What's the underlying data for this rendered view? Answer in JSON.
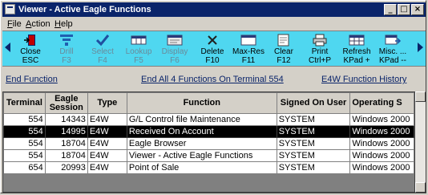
{
  "window": {
    "title": "Viewer - Active Eagle Functions"
  },
  "menu": [
    {
      "key": "F",
      "rest": "ile"
    },
    {
      "key": "A",
      "rest": "ction"
    },
    {
      "key": "H",
      "rest": "elp"
    }
  ],
  "toolbar": {
    "tools": [
      {
        "label": "Close",
        "sub": "ESC",
        "icon": "exit-door-icon",
        "disabled": false
      },
      {
        "label": "Drill",
        "sub": "F3",
        "icon": "funnel-icon",
        "disabled": true
      },
      {
        "label": "Select",
        "sub": "F4",
        "icon": "checkmark-icon",
        "disabled": true
      },
      {
        "label": "Lookup",
        "sub": "F5",
        "icon": "lookup-grid-icon",
        "disabled": true
      },
      {
        "label": "Display",
        "sub": "F6",
        "icon": "display-window-icon",
        "disabled": true
      },
      {
        "label": "Delete",
        "sub": "F10",
        "icon": "delete-x-icon",
        "disabled": false
      },
      {
        "label": "Max-Res",
        "sub": "F11",
        "icon": "maximize-window-icon",
        "disabled": false
      },
      {
        "label": "Clear",
        "sub": "F12",
        "icon": "clear-page-icon",
        "disabled": false
      },
      {
        "label": "Print",
        "sub": "Ctrl+P",
        "icon": "printer-icon",
        "disabled": false
      },
      {
        "label": "Refresh",
        "sub": "KPad +",
        "icon": "refresh-grid-icon",
        "disabled": false
      },
      {
        "label": "Misc. ...",
        "sub": "KPad --",
        "icon": "misc-window-icon",
        "disabled": false
      }
    ]
  },
  "links": {
    "end_function": "End Function",
    "end_all": "End All 4 Functions On Terminal 554",
    "history": "E4W Function History"
  },
  "table": {
    "headers": [
      "Terminal",
      "Eagle Session",
      "Type",
      "Function",
      "Signed On User",
      "Operating S"
    ],
    "rows": [
      [
        "554",
        "14343",
        "E4W",
        "G/L Control file Maintenance",
        "SYSTEM",
        "Windows 2000"
      ],
      [
        "554",
        "14995",
        "E4W",
        "Received On Account",
        "SYSTEM",
        "Windows 2000"
      ],
      [
        "554",
        "18704",
        "E4W",
        "Eagle Browser",
        "SYSTEM",
        "Windows 2000"
      ],
      [
        "554",
        "18704",
        "E4W",
        "Viewer - Active Eagle Functions",
        "SYSTEM",
        "Windows 2000"
      ],
      [
        "654",
        "20993",
        "E4W",
        "Point of Sale",
        "SYSTEM",
        "Windows 2000"
      ]
    ],
    "selected_row": 1
  }
}
